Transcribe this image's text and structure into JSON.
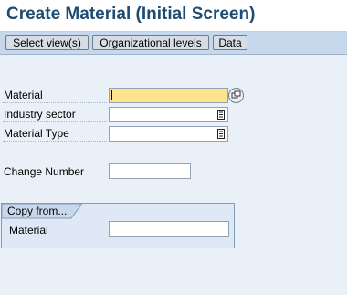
{
  "title": "Create Material (Initial Screen)",
  "toolbar": {
    "select_views": "Select view(s)",
    "org_levels": "Organizational levels",
    "data": "Data"
  },
  "fields": {
    "material": {
      "label": "Material",
      "value": "",
      "required": true
    },
    "industry_sector": {
      "label": "Industry sector",
      "value": ""
    },
    "material_type": {
      "label": "Material Type",
      "value": ""
    },
    "change_number": {
      "label": "Change Number",
      "value": ""
    }
  },
  "copy_from": {
    "title": "Copy from...",
    "material": {
      "label": "Material",
      "value": ""
    }
  },
  "icons": {
    "match_button": "multiple-selection-icon",
    "dropdown": "list-selection-icon"
  },
  "colors": {
    "title_text": "#1f4c72",
    "toolbar_bg": "#c6d8ec",
    "page_bg": "#eaf0f7",
    "required_field": "#ffe38b"
  }
}
